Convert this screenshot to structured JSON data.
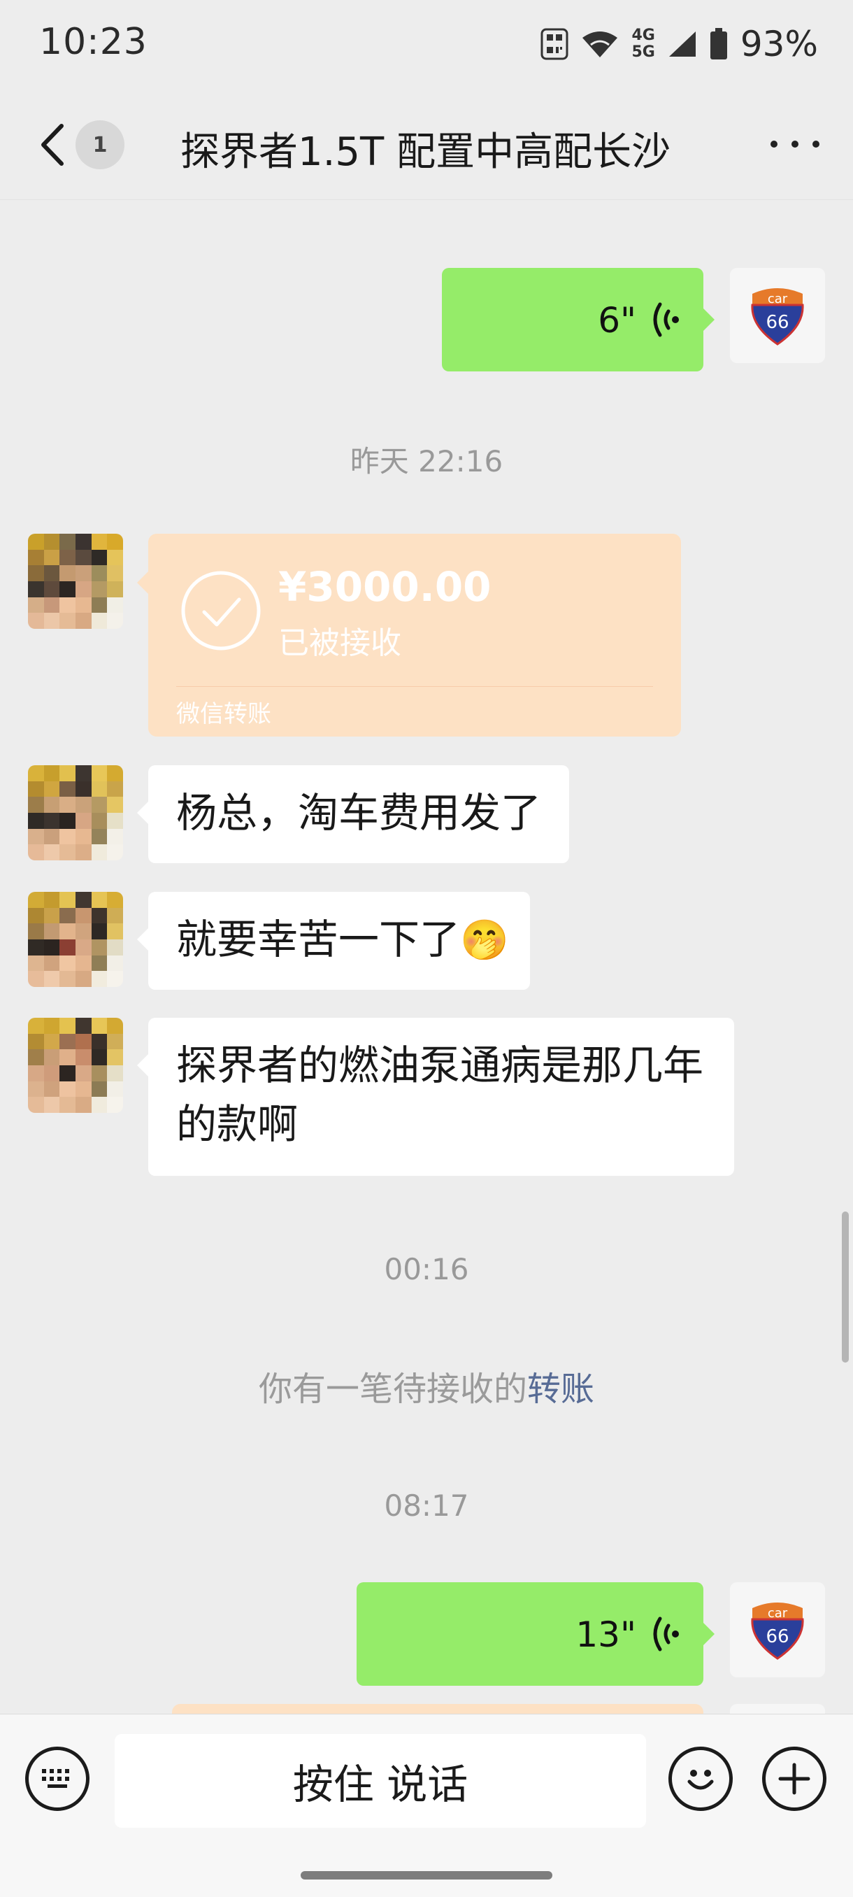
{
  "status_bar": {
    "time": "10:23",
    "network_top": "4G",
    "network_bottom": "5G",
    "battery": "93%",
    "icons": [
      "nfc-icon",
      "wifi-icon",
      "cell-signal-icon",
      "battery-icon"
    ]
  },
  "header": {
    "unread_count": "1",
    "title": "探界者1.5T 配置中高配长沙"
  },
  "messages": {
    "voice_1": {
      "duration": "6\""
    },
    "time_1": "昨天 22:16",
    "transfer": {
      "amount": "¥3000.00",
      "status": "已被接收",
      "footer": "微信转账"
    },
    "text_1": "杨总，淘车费用发了",
    "text_2": "就要幸苦一下了",
    "text_2_emoji": "🤭",
    "text_3": "探界者的燃油泵通病是那几年的款啊",
    "time_2": "00:16",
    "notice_prefix": "你有一笔待接收的",
    "notice_link": "转账",
    "time_3": "08:17",
    "voice_2": {
      "duration": "13\""
    }
  },
  "my_avatar": {
    "top_text": "car",
    "number": "66"
  },
  "input_bar": {
    "hold_to_talk": "按住 说话"
  },
  "colors": {
    "background": "#ededed",
    "my_bubble": "#95ec69",
    "transfer_card": "#fde1c4",
    "link": "#576b95"
  }
}
